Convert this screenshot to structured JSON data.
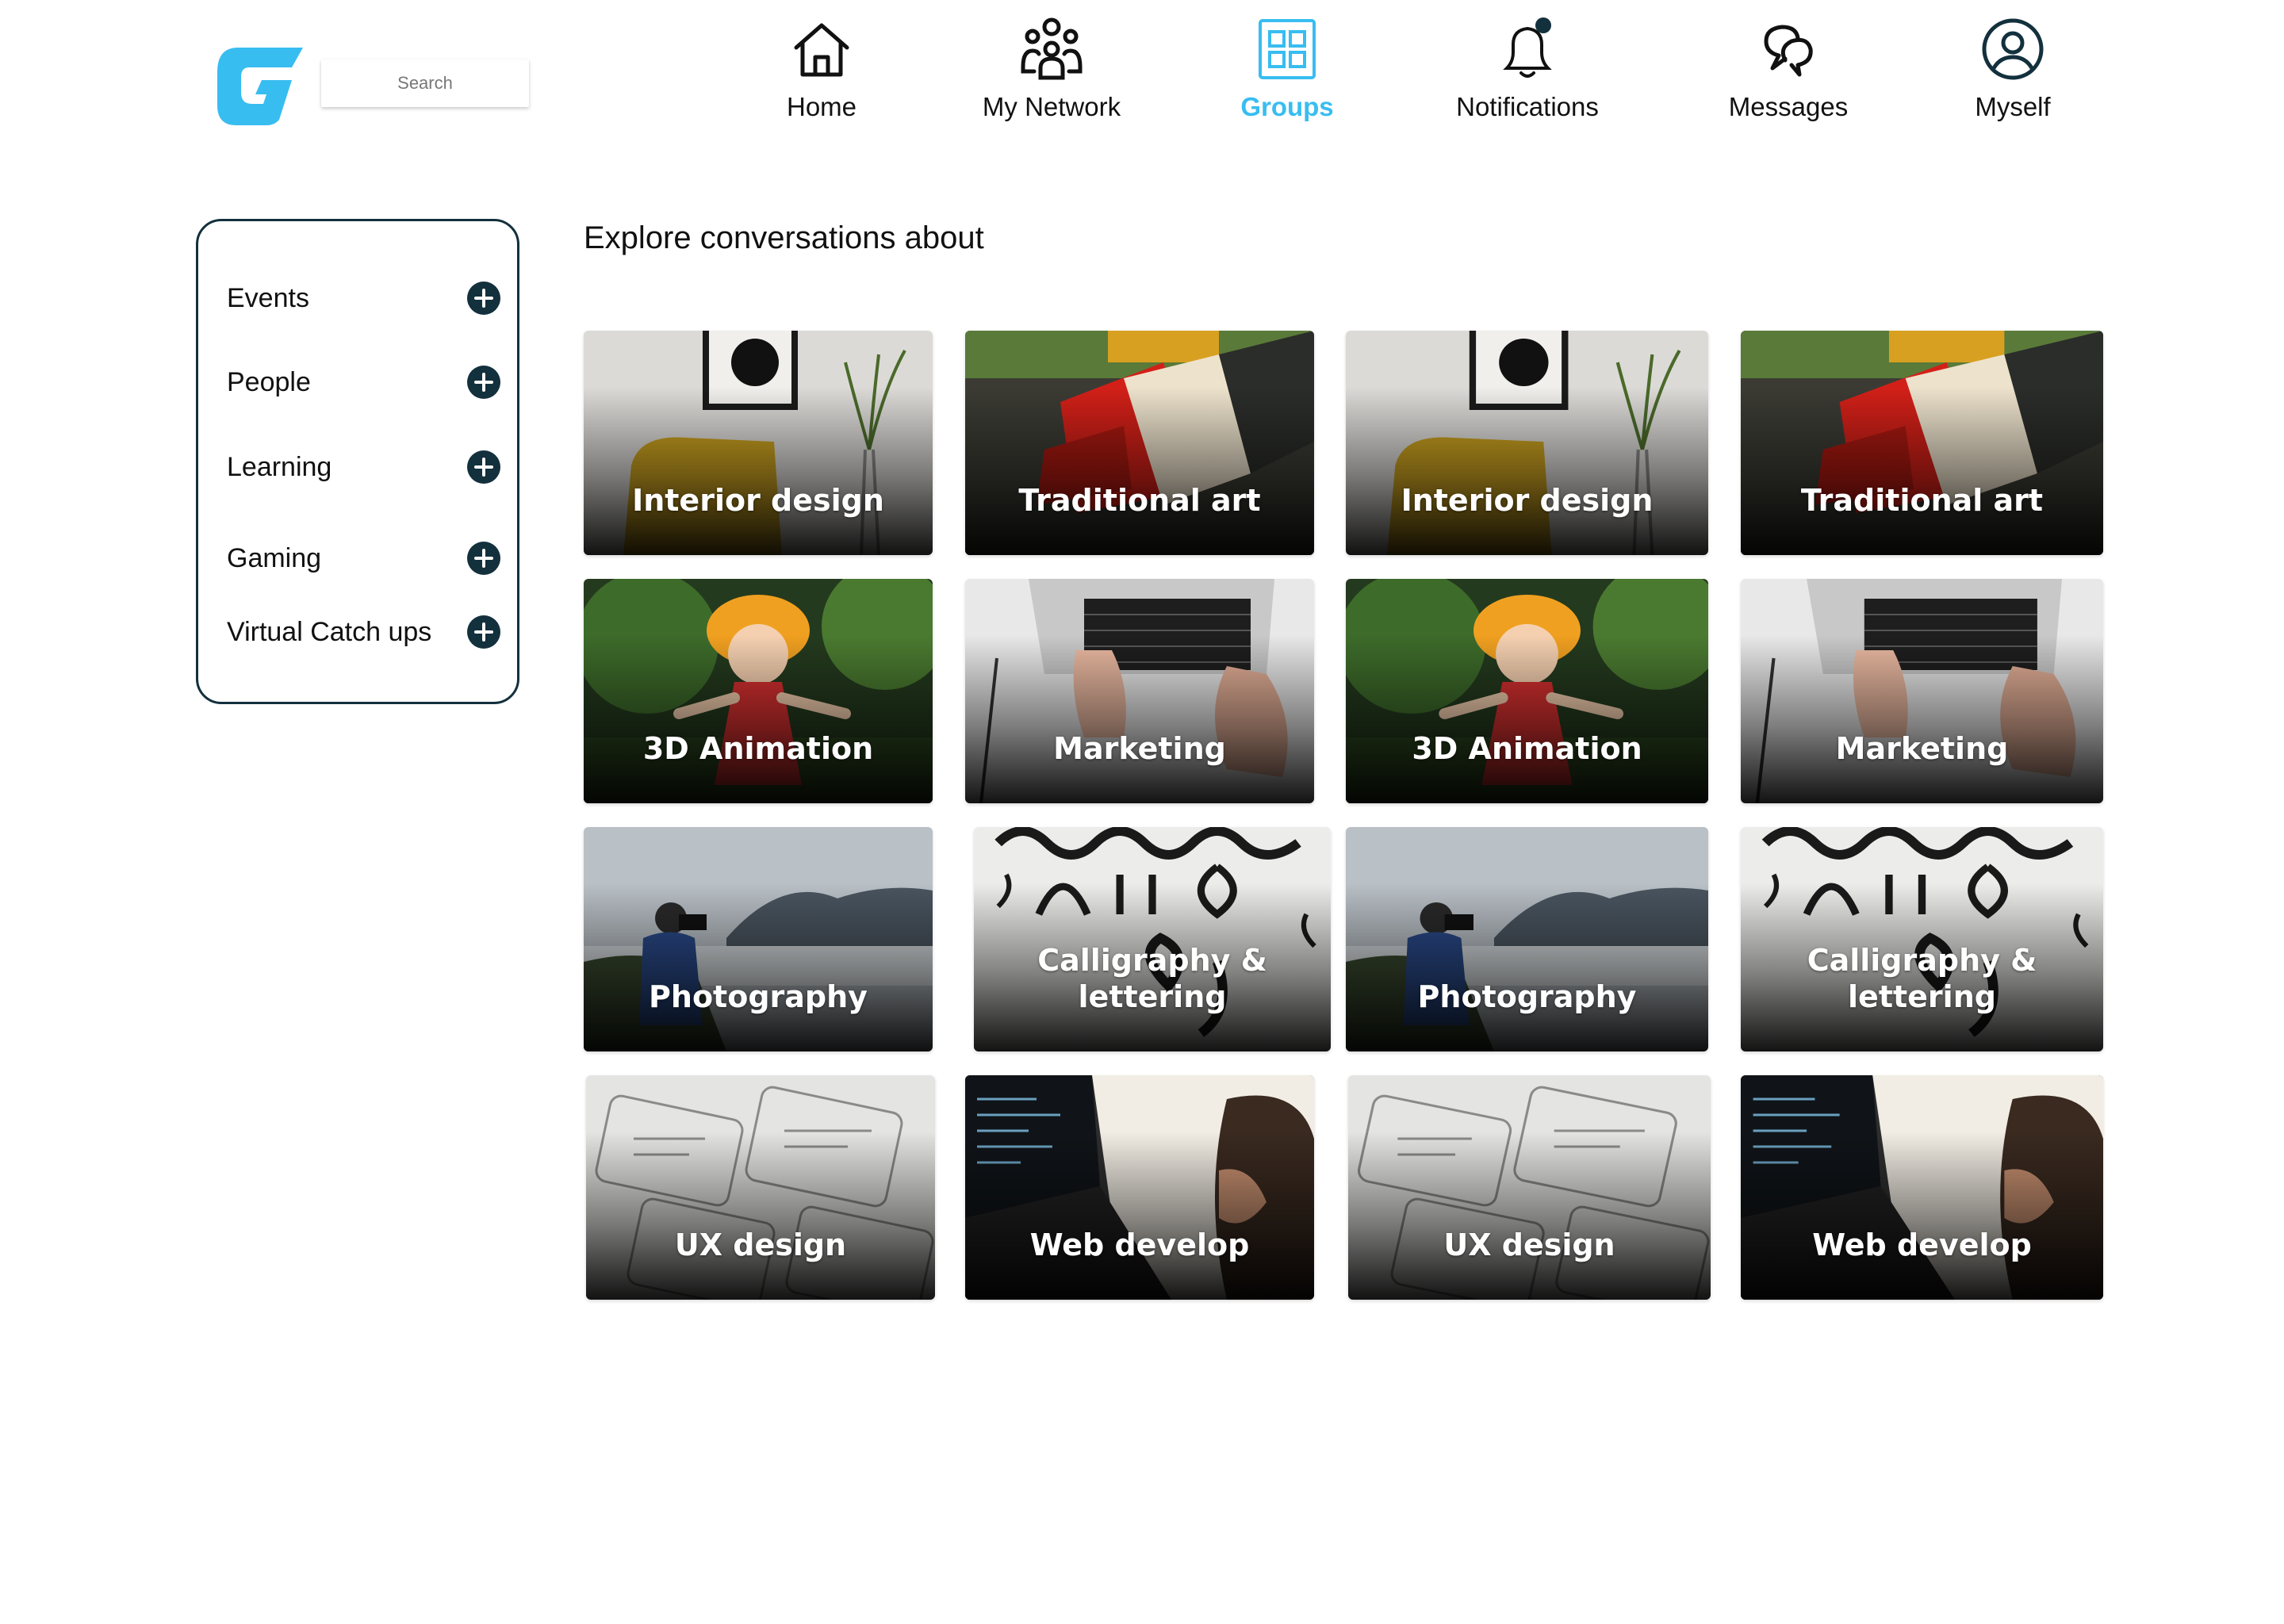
{
  "header": {
    "search_placeholder": "Search",
    "nav": [
      {
        "label": "Home",
        "icon": "home-icon"
      },
      {
        "label": "My Network",
        "icon": "network-icon"
      },
      {
        "label": "Groups",
        "icon": "groups-icon",
        "active": true
      },
      {
        "label": "Notifications",
        "icon": "bell-icon"
      },
      {
        "label": "Messages",
        "icon": "messages-icon"
      },
      {
        "label": "Myself",
        "icon": "user-icon"
      }
    ]
  },
  "sidebar": {
    "items": [
      {
        "label": "Events",
        "icon": "plus-circle-icon"
      },
      {
        "label": "People",
        "icon": "plus-circle-icon"
      },
      {
        "label": "Learning",
        "icon": "plus-circle-icon"
      },
      {
        "label": "Gaming",
        "icon": "plus-circle-icon"
      },
      {
        "label": "Virtual Catch ups",
        "icon": "plus-circle-icon"
      }
    ]
  },
  "main": {
    "heading": "Explore conversations about",
    "cards": [
      {
        "title": "Interior design"
      },
      {
        "title": "Traditional art"
      },
      {
        "title": "Interior design"
      },
      {
        "title": "Traditional art"
      },
      {
        "title": "3D Animation"
      },
      {
        "title": "Marketing"
      },
      {
        "title": "3D Animation"
      },
      {
        "title": "Marketing"
      },
      {
        "title": "Photography"
      },
      {
        "title": "Calligraphy &\nlettering"
      },
      {
        "title": "Photography"
      },
      {
        "title": "Calligraphy &\nlettering"
      },
      {
        "title": "UX design"
      },
      {
        "title": "Web develop"
      },
      {
        "title": "UX design"
      },
      {
        "title": "Web develop"
      }
    ]
  },
  "colors": {
    "accent": "#38bdf0",
    "dark": "#13303d",
    "notification_dot": "#13303d"
  }
}
